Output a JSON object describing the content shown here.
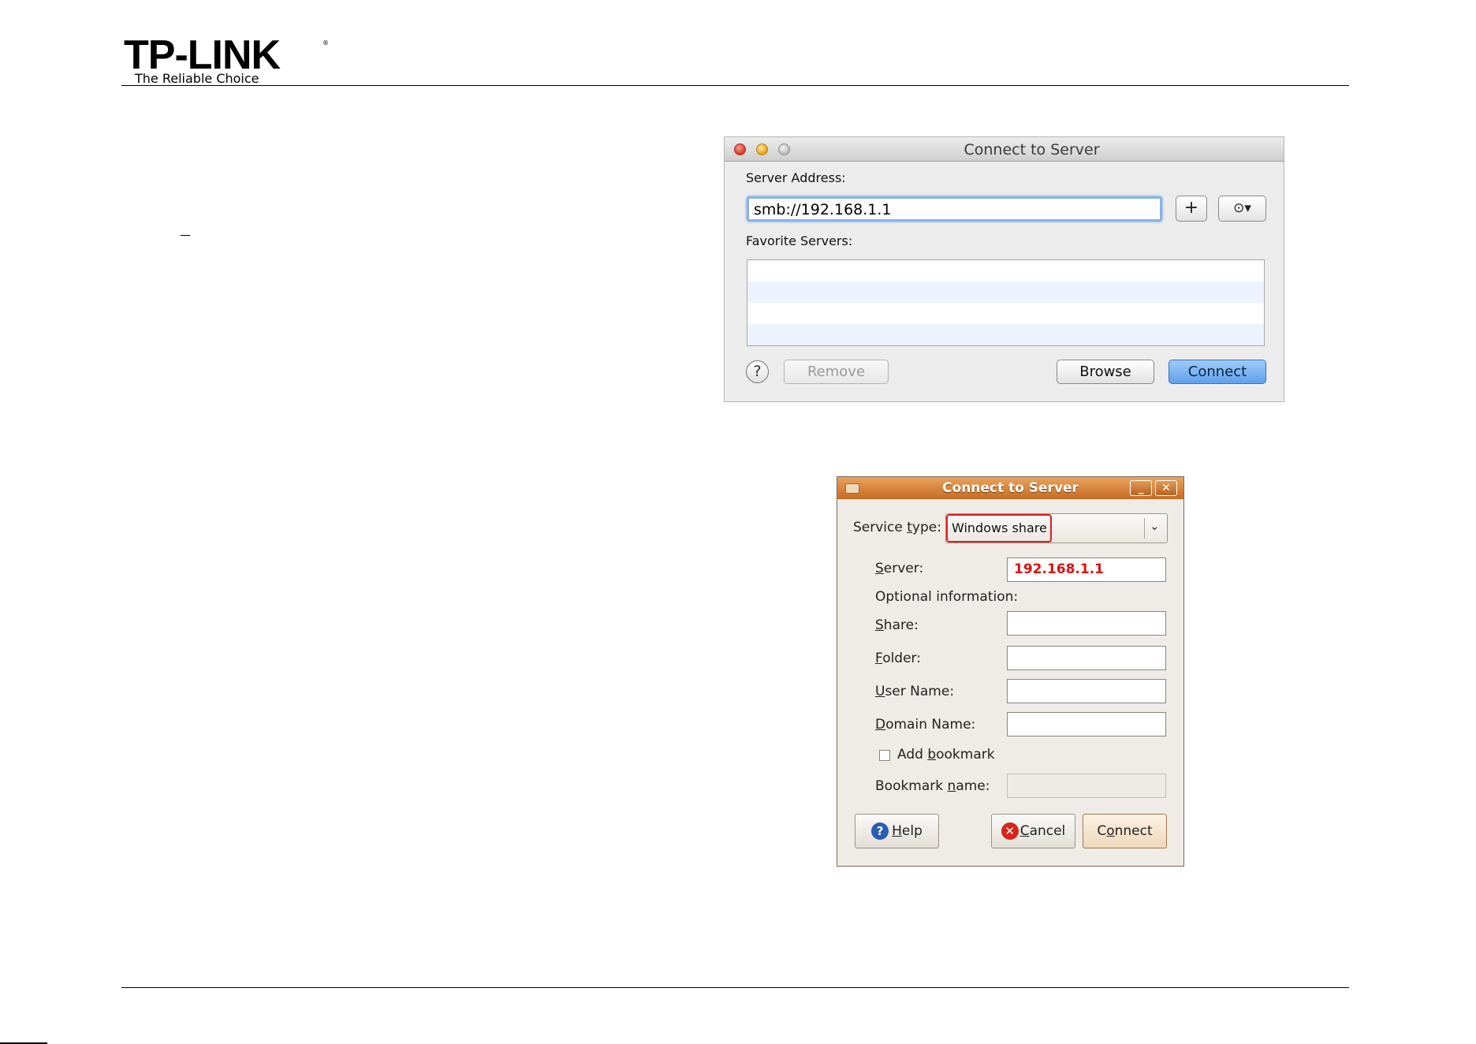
{
  "header": {
    "logo_text": "TP-LINK",
    "logo_reg": "®",
    "tagline": "The Reliable Choice",
    "page_mark": "–"
  },
  "mac_dialog": {
    "title": "Connect to Server",
    "server_address_label": "Server Address:",
    "server_address_value": "smb://192.168.1.1",
    "add_button": "+",
    "recent_button": "⊙▾",
    "favorite_servers_label": "Favorite Servers:",
    "help_button": "?",
    "remove_button": "Remove",
    "browse_button": "Browse",
    "connect_button": "Connect",
    "accent_color": "#5fa1ec"
  },
  "ubuntu_dialog": {
    "title": "Connect to Server",
    "minimize_button": "_",
    "close_button": "✕",
    "service_type_label_pre": "Service ",
    "service_type_label_u": "t",
    "service_type_label_post": "ype:",
    "service_type_value": "Windows share",
    "server_label_u": "S",
    "server_label_post": "erver:",
    "server_value": "192.168.1.1",
    "optional_info_label": "Optional information:",
    "share_label_u": "S",
    "share_label_post": "hare:",
    "folder_label_u": "F",
    "folder_label_post": "older:",
    "user_name_label_u": "U",
    "user_name_label_post": "ser Name:",
    "domain_name_label_u": "D",
    "domain_name_label_post": "omain Name:",
    "add_bookmark_pre": "Add ",
    "add_bookmark_u": "b",
    "add_bookmark_post": "ookmark",
    "bookmark_name_pre": "Bookmark ",
    "bookmark_name_u": "n",
    "bookmark_name_post": "ame:",
    "help_button_u": "H",
    "help_button_post": "elp",
    "cancel_button_u": "C",
    "cancel_button_post": "ancel",
    "connect_button_pre": "C",
    "connect_button_u": "o",
    "connect_button_post": "nnect",
    "highlight_color": "#e31b1b",
    "titlebar_color": "#c76b22"
  }
}
